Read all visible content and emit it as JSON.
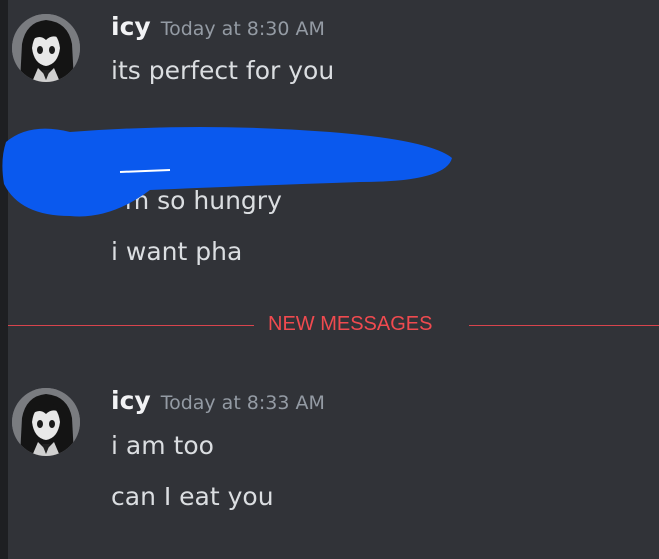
{
  "messages": [
    {
      "username": "icy",
      "timestamp": "Today at 8:30 AM",
      "lines": [
        "its perfect for you",
        "i'm so hungry",
        "i want pha"
      ]
    },
    {
      "username": "icy",
      "timestamp": "Today at 8:33 AM",
      "lines": [
        "i am too",
        "can I eat you"
      ]
    }
  ],
  "divider": {
    "label": "NEW MESSAGES",
    "color": "#f04a4f"
  },
  "redaction": {
    "color": "#0a59ee"
  }
}
